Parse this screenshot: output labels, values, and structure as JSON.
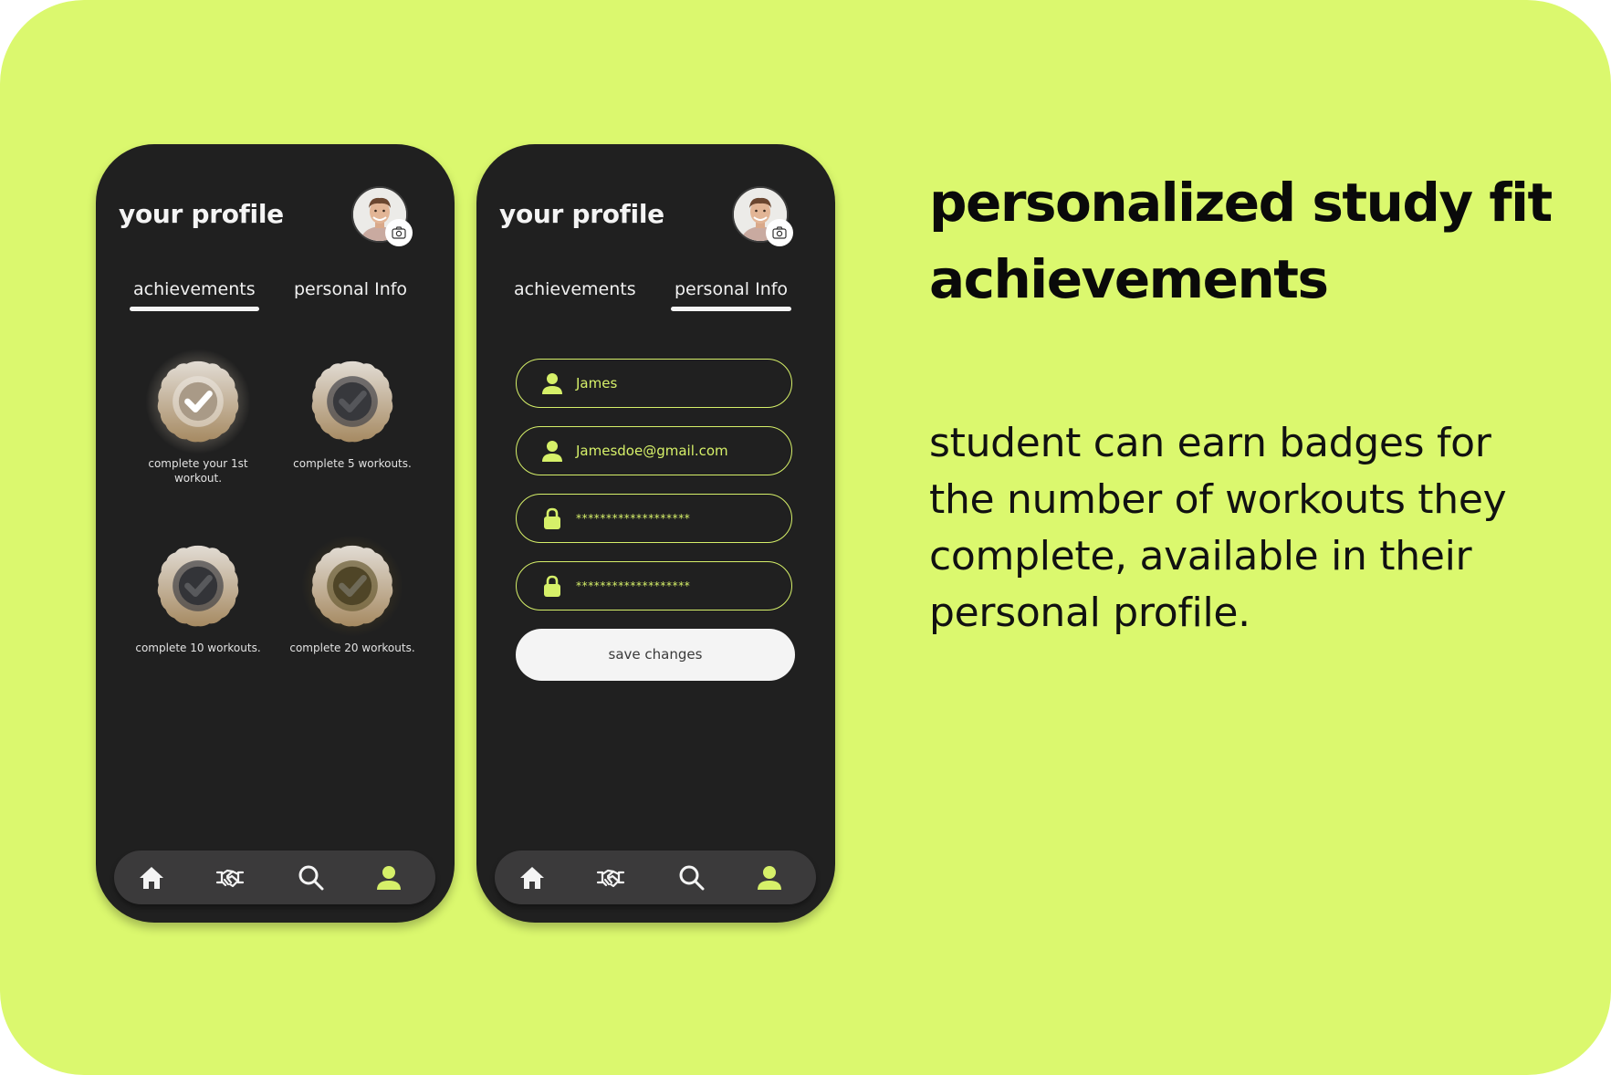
{
  "colors": {
    "background": "#dbf86e",
    "phone": "#202020",
    "accent": "#d6f069",
    "nav_bar": "#3b3a3b"
  },
  "screens": [
    {
      "title": "your profile",
      "tabs": [
        {
          "label": "achievements",
          "active": true
        },
        {
          "label": "personal Info",
          "active": false
        }
      ],
      "badges": [
        {
          "label": "complete your 1st workout.",
          "state": "earned",
          "tier": "silver"
        },
        {
          "label": "complete 5 workouts.",
          "state": "locked",
          "tier": "grey"
        },
        {
          "label": "complete 10 workouts.",
          "state": "locked",
          "tier": "grey"
        },
        {
          "label": "complete 20 workouts.",
          "state": "locked",
          "tier": "gold"
        }
      ],
      "nav": [
        {
          "icon": "home-icon",
          "active": false
        },
        {
          "icon": "handshake-icon",
          "active": false
        },
        {
          "icon": "search-icon",
          "active": false
        },
        {
          "icon": "profile-icon",
          "active": true
        }
      ]
    },
    {
      "title": "your profile",
      "tabs": [
        {
          "label": "achievements",
          "active": false
        },
        {
          "label": "personal Info",
          "active": true
        }
      ],
      "fields": [
        {
          "icon": "user-icon",
          "value": "James"
        },
        {
          "icon": "user-icon",
          "value": "Jamesdoe@gmail.com"
        },
        {
          "icon": "lock-icon",
          "value": "*******************"
        },
        {
          "icon": "lock-icon",
          "value": "*******************"
        }
      ],
      "save_label": "save changes",
      "nav": [
        {
          "icon": "home-icon",
          "active": false
        },
        {
          "icon": "handshake-icon",
          "active": false
        },
        {
          "icon": "search-icon",
          "active": false
        },
        {
          "icon": "profile-icon",
          "active": true
        }
      ]
    }
  ],
  "heading": "personalized study fit achievements",
  "description": "student can earn badges for the number of workouts they complete, available in their personal profile."
}
